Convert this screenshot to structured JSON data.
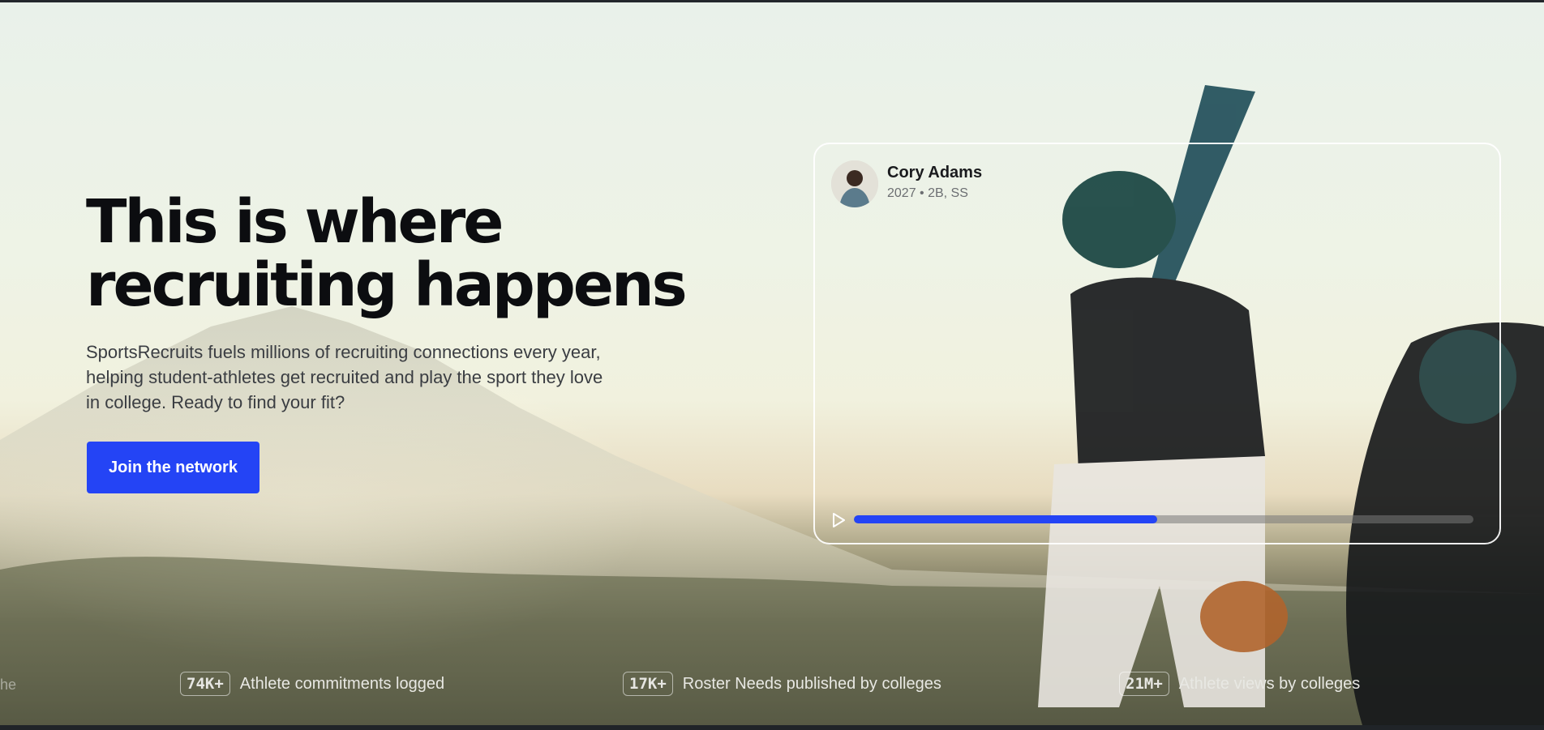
{
  "hero": {
    "title_line1": "This is where",
    "title_line2": "recruiting happens",
    "description": "SportsRecruits fuels millions of recruiting connections every year, helping student-athletes get recruited and play the sport they love in college. Ready to find your fit?",
    "cta_label": "Join the network"
  },
  "video_card": {
    "athlete_name": "Cory Adams",
    "athlete_meta": "2027 • 2B, SS",
    "progress": 0.49,
    "play_icon": "play-icon"
  },
  "edge_text": "he",
  "stats": [
    {
      "value": "74K+",
      "label": "Athlete commitments logged"
    },
    {
      "value": "17K+",
      "label": "Roster Needs published by colleges"
    },
    {
      "value": "21M+",
      "label": "Athlete views by colleges"
    }
  ],
  "colors": {
    "accent": "#2444f5",
    "title_text": "#0c0d10",
    "body_text": "#3a3d42"
  }
}
